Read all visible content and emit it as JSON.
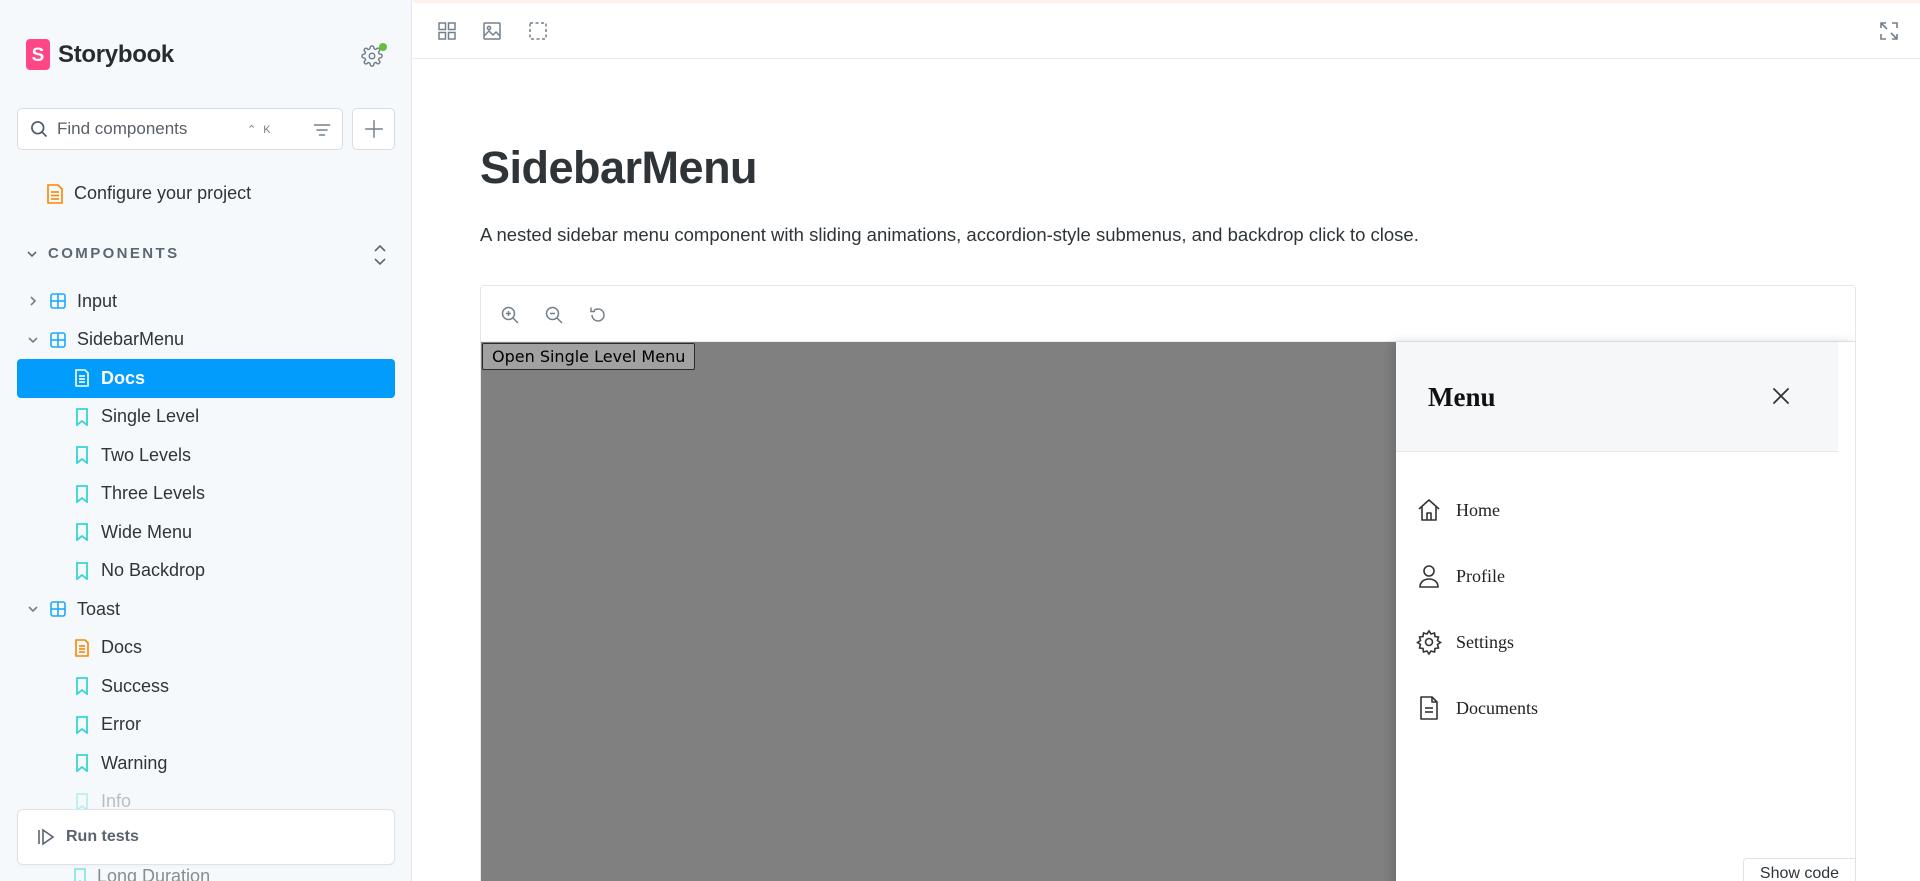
{
  "sidebar": {
    "brand": "Storybook",
    "search": {
      "placeholder": "Find components",
      "shortcut": "⌃ K"
    },
    "configure": "Configure your project",
    "section_title": "COMPONENTS",
    "tree": [
      {
        "label": "Input",
        "kind": "component",
        "level": 0,
        "expanded": false
      },
      {
        "label": "SidebarMenu",
        "kind": "component",
        "level": 0,
        "expanded": true
      },
      {
        "label": "Docs",
        "kind": "docs",
        "level": 1,
        "selected": true
      },
      {
        "label": "Single Level",
        "kind": "story",
        "level": 1
      },
      {
        "label": "Two Levels",
        "kind": "story",
        "level": 1
      },
      {
        "label": "Three Levels",
        "kind": "story",
        "level": 1
      },
      {
        "label": "Wide Menu",
        "kind": "story",
        "level": 1
      },
      {
        "label": "No Backdrop",
        "kind": "story",
        "level": 1
      },
      {
        "label": "Toast",
        "kind": "component",
        "level": 0,
        "expanded": true
      },
      {
        "label": "Docs",
        "kind": "docs",
        "level": 1
      },
      {
        "label": "Success",
        "kind": "story",
        "level": 1
      },
      {
        "label": "Error",
        "kind": "story",
        "level": 1
      },
      {
        "label": "Warning",
        "kind": "story",
        "level": 1
      },
      {
        "label": "Info",
        "kind": "story",
        "level": 1,
        "faded": true
      }
    ],
    "peek_item": "Long Duration",
    "run_tests": "Run tests"
  },
  "doc": {
    "title": "SidebarMenu",
    "description": "A nested sidebar menu component with sliding animations, accordion-style submenus, and backdrop click to close."
  },
  "preview": {
    "open_button": "Open Single Level Menu",
    "menu_title": "Menu",
    "menu_items": [
      {
        "label": "Home",
        "icon": "home-icon"
      },
      {
        "label": "Profile",
        "icon": "user-icon"
      },
      {
        "label": "Settings",
        "icon": "settings-icon"
      },
      {
        "label": "Documents",
        "icon": "document-icon"
      }
    ],
    "show_code": "Show code"
  },
  "colors": {
    "accent": "#029cfd",
    "brand": "#ff4785",
    "status_dot": "#66bf3c",
    "component_icon": "#1ea7fd",
    "story_icon": "#37d5d3",
    "docs_icon": "#ff8300",
    "backdrop": "#808080"
  }
}
